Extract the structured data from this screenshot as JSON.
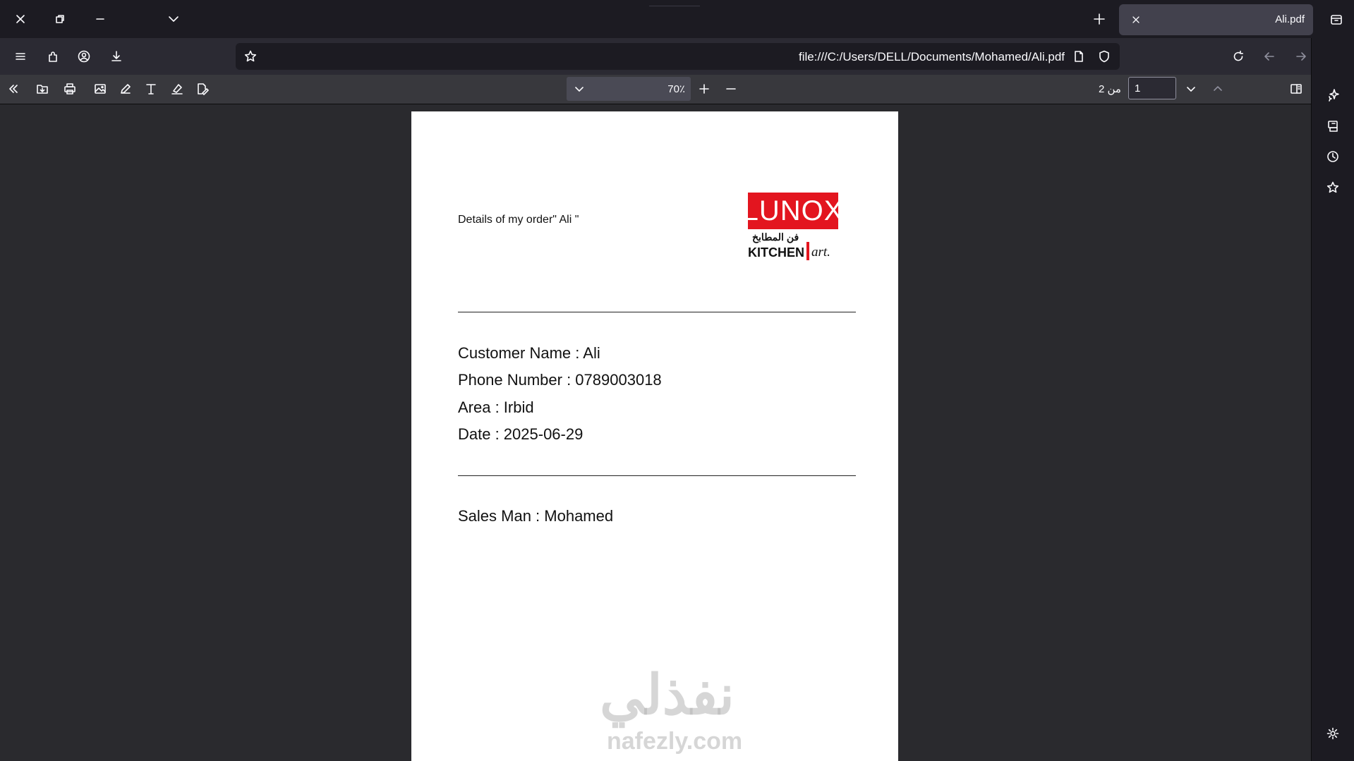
{
  "window": {
    "tab_title": "Ali.pdf"
  },
  "navbar": {
    "url": "file:///C:/Users/DELL/Documents/Mohamed/Ali.pdf"
  },
  "pdf_toolbar": {
    "zoom": "70٪",
    "page_number": "1",
    "page_count_label": "من 2"
  },
  "document": {
    "order_title": "Details of my order\" Ali \"",
    "logo": {
      "brand": "LUNOX",
      "arabic": "فن المطابخ",
      "kitchen": "KITCHEN",
      "art": "art."
    },
    "customer_name": "Customer Name : Ali",
    "phone_number": "Phone Number : 0789003018",
    "area": "Area : Irbid",
    "date": "Date : 2025-06-29",
    "sales_man": "Sales Man : Mohamed",
    "watermark_arabic": "نفذلي",
    "watermark_latin": "nafezly.com"
  },
  "icons": {
    "close": "close-icon",
    "restore": "restore-icon",
    "minimize": "minimize-icon",
    "tab_list": "chevron-down-icon",
    "new_tab": "plus-icon",
    "container": "container-icon",
    "menu": "hamburger-icon",
    "extensions": "puzzle-icon",
    "account": "account-icon",
    "downloads": "download-icon",
    "bookmark": "star-icon",
    "page": "page-icon",
    "shield": "shield-icon",
    "reload": "reload-icon",
    "back": "arrow-left-icon",
    "forward": "arrow-right-icon",
    "sidebar_toggle": "sidebar-icon"
  },
  "colors": {
    "brand_red": "#e3151f",
    "chrome_dark": "#1c1b22",
    "chrome_mid": "#2b2a33",
    "toolbar": "#38383d"
  }
}
